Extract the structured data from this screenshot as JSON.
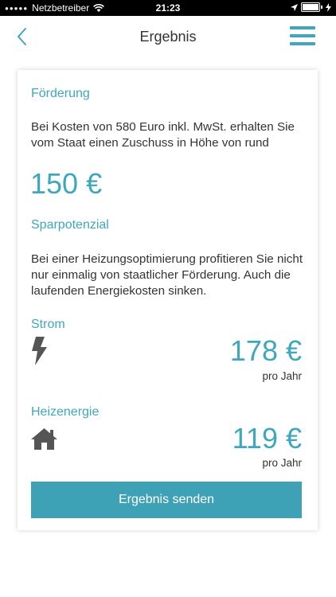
{
  "status": {
    "carrier": "Netzbetreiber",
    "time": "21:23"
  },
  "nav": {
    "title": "Ergebnis"
  },
  "funding": {
    "heading": "Förderung",
    "text": "Bei Kosten von 580 Euro inkl. MwSt. erhalten Sie vom Staat einen Zuschuss in Höhe von rund",
    "amount": "150 €"
  },
  "savings": {
    "heading": "Sparpotenzial",
    "text": "Bei einer Heizungsoptimierung profitieren Sie nicht nur einmalig von staatlicher Förderung. Auch die laufenden Energiekosten sinken."
  },
  "electricity": {
    "label": "Strom",
    "amount": "178 €",
    "unit": "pro Jahr",
    "icon": "lightning-icon"
  },
  "heating": {
    "label": "Heizenergie",
    "amount": "119 €",
    "unit": "pro Jahr",
    "icon": "house-icon"
  },
  "button": {
    "label": "Ergebnis senden"
  },
  "colors": {
    "accent": "#3ea7bd",
    "button": "#3ea1b5"
  }
}
